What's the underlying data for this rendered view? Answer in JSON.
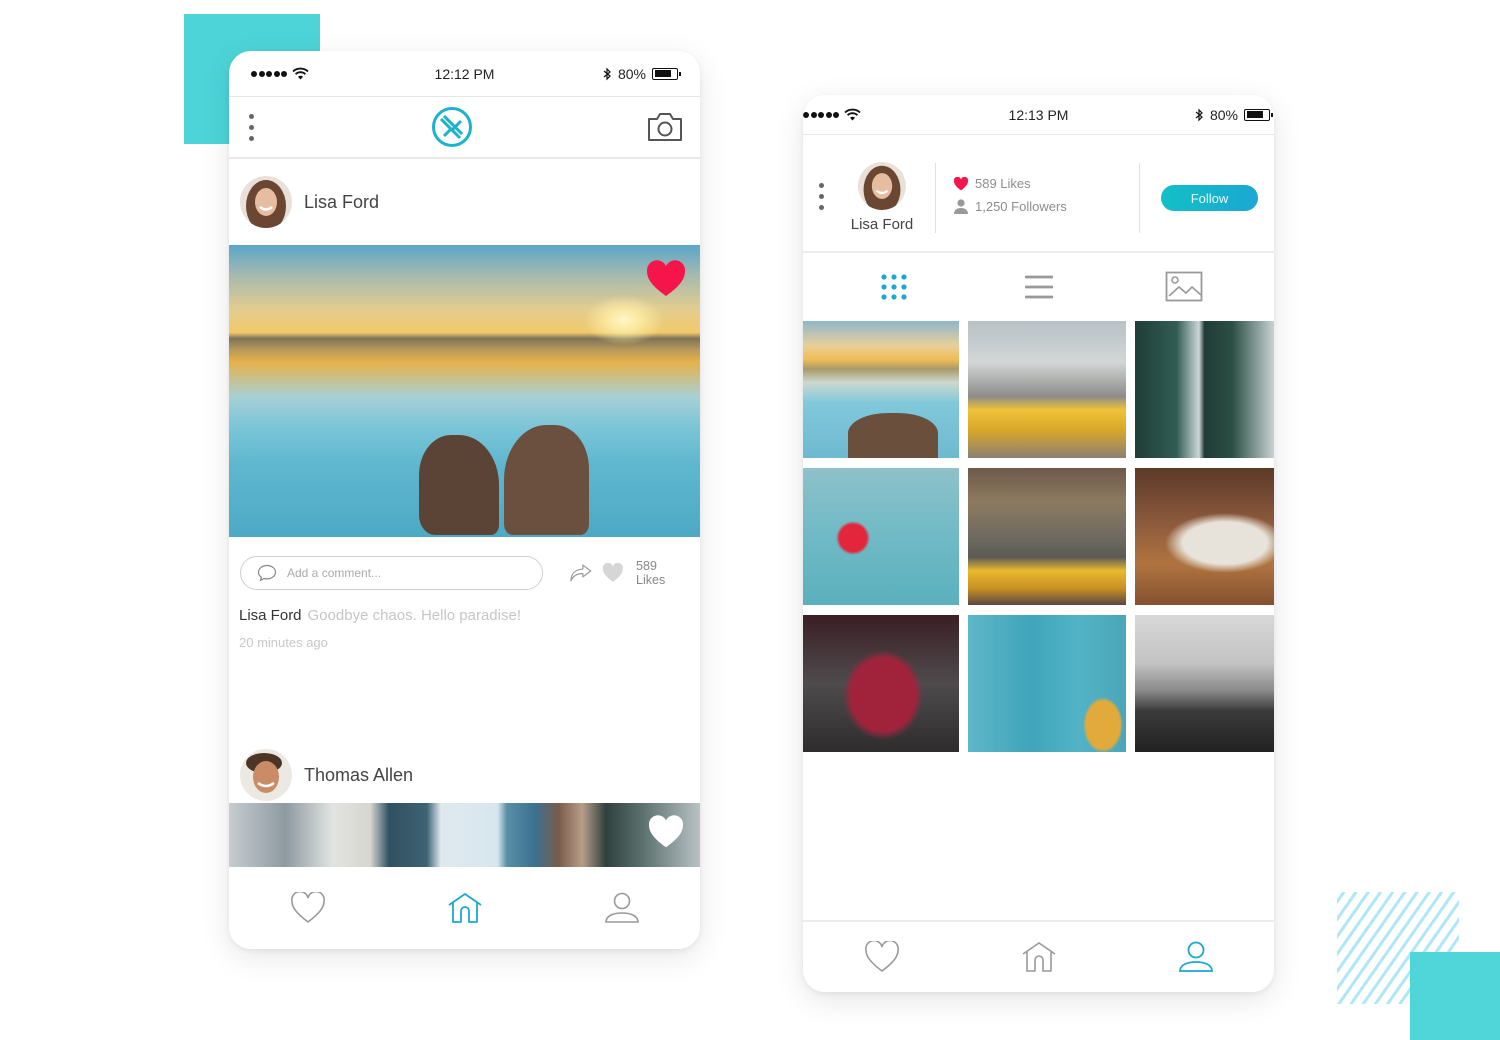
{
  "colors": {
    "accent": "#1ba8d0",
    "like_red": "#f5154a",
    "decor_teal": "#4dd4d8"
  },
  "feed_screen": {
    "status_bar": {
      "time": "12:12 PM",
      "battery_percent_label": "80%",
      "battery_level": 0.8,
      "icons": [
        "signal-dots-icon",
        "wifi-icon",
        "bluetooth-icon",
        "battery-icon"
      ]
    },
    "header": {
      "left_icon": "more-vertical-icon",
      "logo_icon": "app-logo-icon",
      "right_icon": "camera-icon"
    },
    "posts": [
      {
        "author": "Lisa Ford",
        "image": "waterfall-sunset",
        "liked": true,
        "comment_placeholder": "Add a comment...",
        "likes_label": "589 Likes",
        "caption_author": "Lisa Ford",
        "caption_text": "Goodbye chaos. Hello paradise!",
        "timestamp": "20 minutes ago"
      },
      {
        "author": "Thomas Allen",
        "image": "city-buildings",
        "liked": false
      }
    ],
    "bottom_nav": [
      {
        "name": "likes",
        "icon": "heart-outline-icon",
        "active": false
      },
      {
        "name": "home",
        "icon": "home-icon",
        "active": true
      },
      {
        "name": "profile",
        "icon": "user-icon",
        "active": false
      }
    ]
  },
  "profile_screen": {
    "status_bar": {
      "time": "12:13 PM",
      "battery_percent_label": "80%",
      "battery_level": 0.8
    },
    "profile": {
      "name": "Lisa Ford",
      "likes_label": "589 Likes",
      "followers_label": "1,250 Followers",
      "follow_button": "Follow"
    },
    "view_tabs": [
      {
        "name": "grid",
        "icon": "grid-icon",
        "active": true
      },
      {
        "name": "list",
        "icon": "list-icon",
        "active": false
      },
      {
        "name": "media",
        "icon": "image-icon",
        "active": false
      }
    ],
    "photos": [
      "waterfall-sunset",
      "city-taxis",
      "bridge-underside",
      "heart-balloon",
      "yellow-taxi-street",
      "coffee-mugs",
      "berry-smoothie",
      "guitar-blue-wood",
      "mountain-hiker"
    ],
    "bottom_nav": [
      {
        "name": "likes",
        "icon": "heart-outline-icon",
        "active": false
      },
      {
        "name": "home",
        "icon": "home-icon",
        "active": false
      },
      {
        "name": "profile",
        "icon": "user-icon",
        "active": true
      }
    ]
  }
}
